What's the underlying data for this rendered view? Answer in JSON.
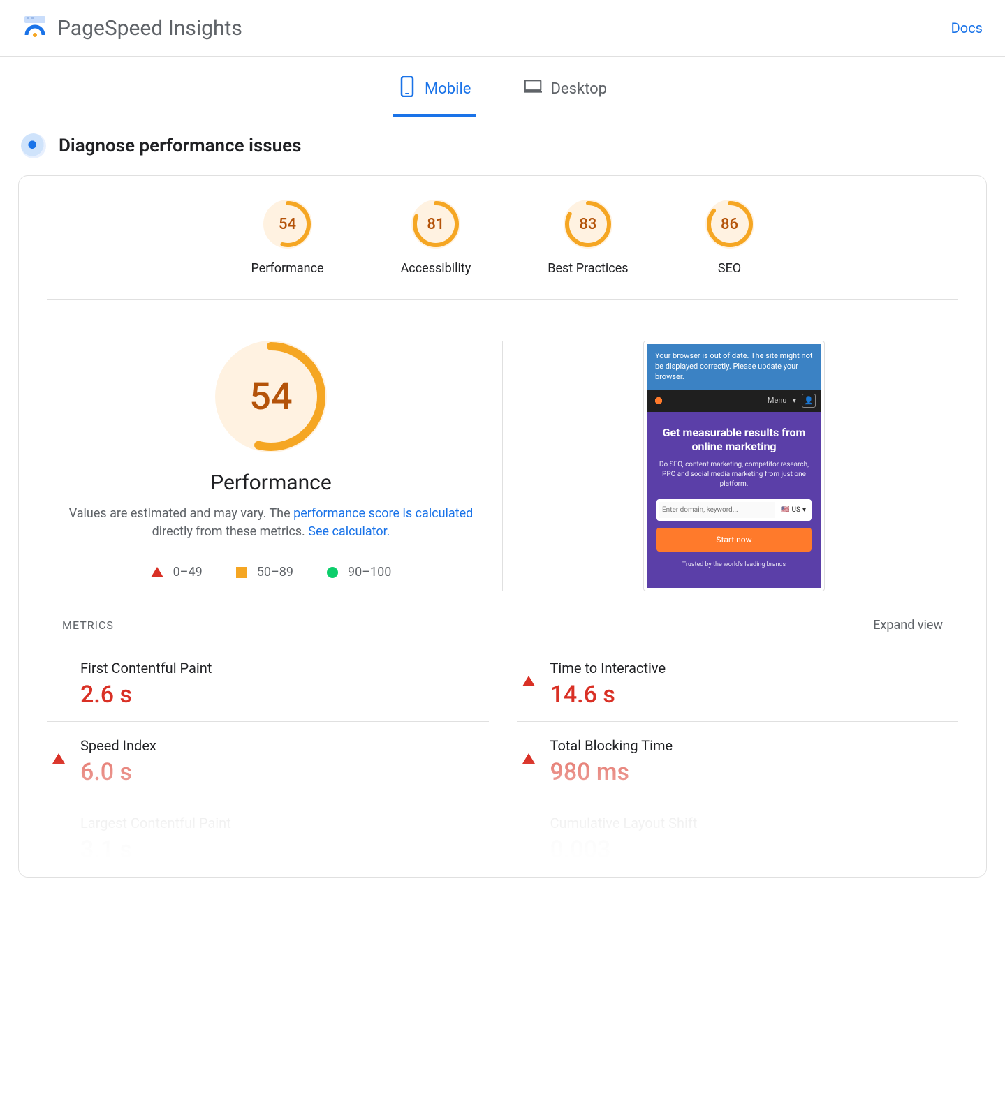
{
  "header": {
    "brand": "PageSpeed Insights",
    "docs": "Docs"
  },
  "tabs": {
    "mobile": "Mobile",
    "desktop": "Desktop",
    "active": "mobile"
  },
  "diagnose": {
    "title": "Diagnose performance issues"
  },
  "scores": [
    {
      "value": 54,
      "label": "Performance"
    },
    {
      "value": 81,
      "label": "Accessibility"
    },
    {
      "value": 83,
      "label": "Best Practices"
    },
    {
      "value": 86,
      "label": "SEO"
    }
  ],
  "perf": {
    "value": 54,
    "label": "Performance",
    "note_pre": "Values are estimated and may vary. The ",
    "note_link1": "performance score is calculated",
    "note_mid": " directly from these metrics. ",
    "note_link2": "See calculator."
  },
  "legend": {
    "r0": "0–49",
    "r1": "50–89",
    "r2": "90–100"
  },
  "screenshot": {
    "banner": "Your browser is out of date. The site might not be displayed correctly. Please update your browser.",
    "menu": "Menu",
    "hero_title": "Get measurable results from online marketing",
    "hero_sub": "Do SEO, content marketing, competitor research, PPC and social media marketing from just one platform.",
    "placeholder": "Enter domain, keyword...",
    "locale": "US",
    "cta": "Start now",
    "trust": "Trusted by the world's leading brands"
  },
  "metrics": {
    "title": "METRICS",
    "expand": "Expand view",
    "items": [
      {
        "icon": "square-orange",
        "name": "First Contentful Paint",
        "value": "2.6 s",
        "style": "val-red"
      },
      {
        "icon": "tri-red",
        "name": "Time to Interactive",
        "value": "14.6 s",
        "style": "val-red"
      },
      {
        "icon": "tri-red",
        "name": "Speed Index",
        "value": "6.0 s",
        "style": "val-pink"
      },
      {
        "icon": "tri-red",
        "name": "Total Blocking Time",
        "value": "980 ms",
        "style": "val-pink"
      },
      {
        "icon": "square-faded",
        "name": "Largest Contentful Paint",
        "value": "3.1 s",
        "style": "val-faded",
        "nameStyle": "name-faded"
      },
      {
        "icon": "circ-gray",
        "name": "Cumulative Layout Shift",
        "value": "0.003",
        "style": "val-faded",
        "nameStyle": "name-faded"
      }
    ]
  }
}
